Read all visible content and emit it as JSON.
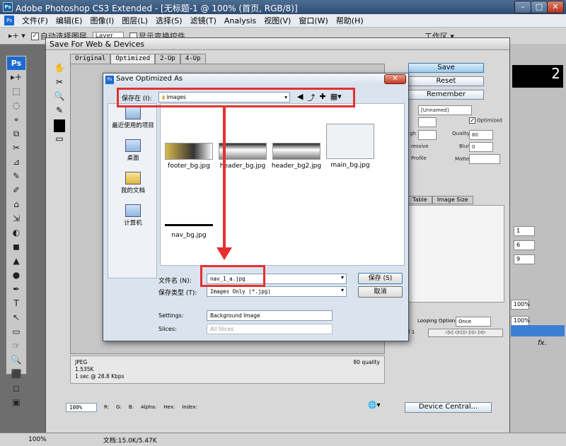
{
  "app": {
    "title": "Adobe Photoshop CS3 Extended - [无标题-1 @ 100% (首页, RGB/8)]",
    "minimize": "–",
    "maximize": "□",
    "close": "✕"
  },
  "menu": [
    "文件(F)",
    "编辑(E)",
    "图像(I)",
    "图层(L)",
    "选择(S)",
    "滤镜(T)",
    "Analysis",
    "视图(V)",
    "窗口(W)",
    "帮助(H)"
  ],
  "options": {
    "auto_select": "自动选择图层",
    "layer": "Layer",
    "show_transform": "显示变换控件",
    "workspace": "工作区 ▾"
  },
  "tools": [
    "Ps",
    "▸+",
    "⬚",
    "◌",
    "⌖",
    "⧉",
    "✂",
    "⊿",
    "✎",
    "✐",
    "⌂",
    "⇲",
    "◐",
    "◼",
    "▲",
    "●",
    "✒",
    "T",
    "↖",
    "▭",
    "☞",
    "🔍",
    "⬛",
    "◻",
    "▣"
  ],
  "sfw": {
    "title": "Save For Web & Devices",
    "tabs": [
      "Original",
      "Optimized",
      "2-Up",
      "4-Up"
    ],
    "buttons": {
      "save": "Save",
      "reset": "Reset",
      "remember": "Remember",
      "device_central": "Device Central..."
    },
    "preset": "[Unnamed]",
    "optimized": "Optimized",
    "quality_label": "Quality:",
    "quality": "80",
    "blur_label": "Blur:",
    "blur": "0",
    "matte_label": "Matte:",
    "progressive": "ressive",
    "profile": "Profile",
    "high": "gh",
    "color_tabs": [
      "Table",
      "Image Size"
    ],
    "looping_label": "Looping Options:",
    "looping": "Once",
    "frame": "f 1",
    "info": {
      "format": "JPEG",
      "size": "1.535K",
      "time": "1 sec @ 28.8 Kbps",
      "quality": "80 quality"
    },
    "zoom": "100%",
    "status": {
      "r": "R:",
      "g": "G:",
      "b": "B:",
      "alpha": "Alpha:",
      "hex": "Hex:",
      "index": "Index:",
      "dash": "--"
    }
  },
  "dialog": {
    "title": "Save Optimized As",
    "save_in_label": "保存在 (I):",
    "folder": "images",
    "places": [
      "最近使用的项目",
      "桌面",
      "我的文档",
      "计算机"
    ],
    "files": [
      "footer_bg.jpg",
      "header_bg.jpg",
      "header_bg2.jpg",
      "main_bg.jpg",
      "nav_bg.jpg"
    ],
    "filename_label": "文件名 (N):",
    "filename": "nav_1_a.jpg",
    "filetype_label": "保存类型 (T):",
    "filetype": "Images Only (*.jpg)",
    "save": "保存 (S)",
    "cancel": "取消",
    "settings_label": "Settings:",
    "settings": "Background Image",
    "slices_label": "Slices:",
    "slices": "All Slices"
  },
  "right": {
    "vals": [
      "1",
      "6",
      "9"
    ],
    "zoom1": "100%",
    "zoom2": "100%",
    "fx": "fx."
  },
  "statusbar": {
    "zoom": "100%",
    "doc": "文档:15.0K/5.47K"
  },
  "colors": {
    "accent": "#e53030",
    "title": "#2f4c71"
  }
}
